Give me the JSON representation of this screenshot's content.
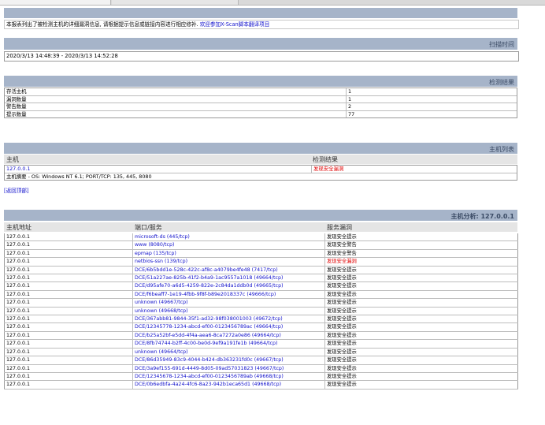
{
  "intro": {
    "text": "本报表列出了被检测主机的详细漏洞信息, 请根据提示信息或链接内容进行相应修补. ",
    "link": "欢迎参加X-Scan脚本翻译项目"
  },
  "scan_time": {
    "title": "扫描时间",
    "value": "2020/3/13 14:48:39 - 2020/3/13 14:52:28"
  },
  "results": {
    "title": "检测结果",
    "rows": [
      {
        "label": "存活主机",
        "value": "1"
      },
      {
        "label": "漏洞数量",
        "value": "1"
      },
      {
        "label": "警告数量",
        "value": "2"
      },
      {
        "label": "提示数量",
        "value": "77"
      }
    ]
  },
  "host_list": {
    "title": "主机列表",
    "col_host": "主机",
    "col_result": "检测结果",
    "host": "127.0.0.1",
    "result": "发现安全漏洞",
    "summary": "主机摘要 - OS: Windows NT 6.1; PORT/TCP: 135, 445, 8080",
    "back_to_top": "[返回顶部]"
  },
  "analysis": {
    "title": "主机分析: 127.0.0.1",
    "col_addr": "主机地址",
    "col_port": "端口/服务",
    "col_vuln": "服务漏洞",
    "rows": [
      {
        "addr": "127.0.0.1",
        "port": "microsoft-ds (445/tcp)",
        "vuln": "发现安全提示",
        "severity": "info"
      },
      {
        "addr": "127.0.0.1",
        "port": "www (8080/tcp)",
        "vuln": "发现安全警告",
        "severity": "info"
      },
      {
        "addr": "127.0.0.1",
        "port": "epmap (135/tcp)",
        "vuln": "发现安全警告",
        "severity": "info"
      },
      {
        "addr": "127.0.0.1",
        "port": "netbios-ssn (139/tcp)",
        "vuln": "发现安全漏洞",
        "severity": "hole"
      },
      {
        "addr": "127.0.0.1",
        "port": "DCE/6b5bdd1e-528c-422c-af8c-a4079be4fe48 (7417/tcp)",
        "vuln": "发现安全提示",
        "severity": "info"
      },
      {
        "addr": "127.0.0.1",
        "port": "DCE/51a227ae-825b-41f2-b4a9-1ac9557a1018 (49664/tcp)",
        "vuln": "发现安全提示",
        "severity": "info"
      },
      {
        "addr": "127.0.0.1",
        "port": "DCE/d95afe70-a6d5-4259-822e-2c84da1ddb0d (49665/tcp)",
        "vuln": "发现安全提示",
        "severity": "info"
      },
      {
        "addr": "127.0.0.1",
        "port": "DCE/f6beaff7-1e19-4fbb-9f8f-b89e2018337c (49666/tcp)",
        "vuln": "发现安全提示",
        "severity": "info"
      },
      {
        "addr": "127.0.0.1",
        "port": "unknown (49667/tcp)",
        "vuln": "发现安全提示",
        "severity": "info"
      },
      {
        "addr": "127.0.0.1",
        "port": "unknown (49668/tcp)",
        "vuln": "发现安全提示",
        "severity": "info"
      },
      {
        "addr": "127.0.0.1",
        "port": "DCE/367abb81-9844-35f1-ad32-98f038001003 (49672/tcp)",
        "vuln": "发现安全提示",
        "severity": "info"
      },
      {
        "addr": "127.0.0.1",
        "port": "DCE/12345778-1234-abcd-ef00-0123456789ac (49664/tcp)",
        "vuln": "发现安全提示",
        "severity": "info"
      },
      {
        "addr": "127.0.0.1",
        "port": "DCE/b25a52bf-e5dd-4f4a-aea6-8ca7272a0e86 (49664/tcp)",
        "vuln": "发现安全提示",
        "severity": "info"
      },
      {
        "addr": "127.0.0.1",
        "port": "DCE/8fb74744-b2ff-4c00-be0d-9ef9a191fe1b (49664/tcp)",
        "vuln": "发现安全提示",
        "severity": "info"
      },
      {
        "addr": "127.0.0.1",
        "port": "unknown (49664/tcp)",
        "vuln": "发现安全提示",
        "severity": "info"
      },
      {
        "addr": "127.0.0.1",
        "port": "DCE/86d35949-83c9-4044-b424-db363231fd0c (49667/tcp)",
        "vuln": "发现安全提示",
        "severity": "info"
      },
      {
        "addr": "127.0.0.1",
        "port": "DCE/3a9ef155-691d-4449-8d05-09ad57031823 (49667/tcp)",
        "vuln": "发现安全提示",
        "severity": "info"
      },
      {
        "addr": "127.0.0.1",
        "port": "DCE/12345678-1234-abcd-ef00-0123456789ab (49668/tcp)",
        "vuln": "发现安全提示",
        "severity": "info"
      },
      {
        "addr": "127.0.0.1",
        "port": "DCE/0b6edbfa-4a24-4fc6-8a23-942b1eca65d1 (49668/tcp)",
        "vuln": "发现安全提示",
        "severity": "info"
      }
    ]
  },
  "colors": {
    "header_bar": "#a6b4c9",
    "link": "#1111cc",
    "hole": "#e00000"
  }
}
